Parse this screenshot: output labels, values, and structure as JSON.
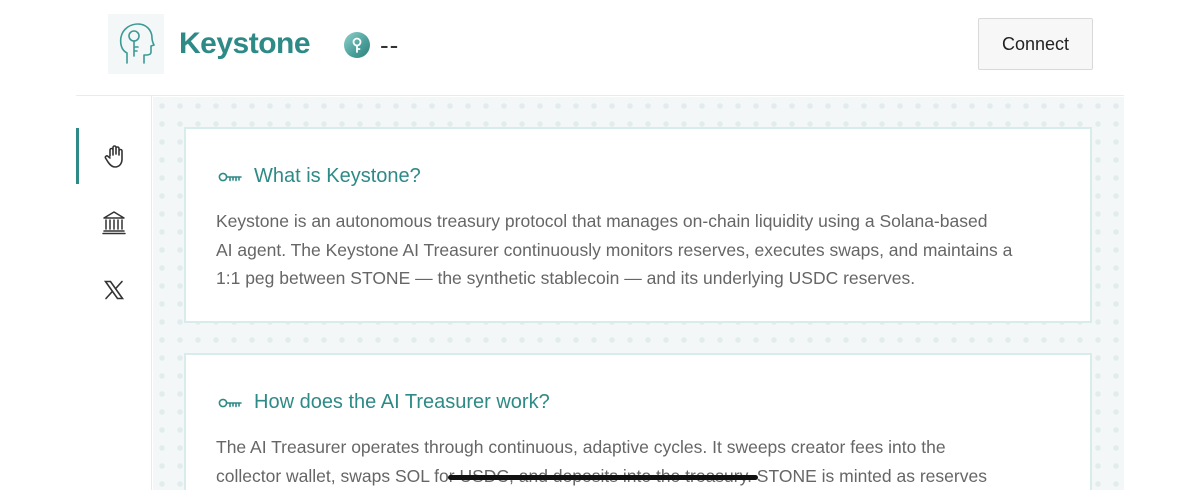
{
  "header": {
    "brand": "Keystone",
    "token_value": "--",
    "connect_label": "Connect"
  },
  "sidebar": {
    "items": [
      {
        "icon": "hand-icon",
        "active": true
      },
      {
        "icon": "bank-icon",
        "active": false
      },
      {
        "icon": "x-logo-icon",
        "active": false
      }
    ]
  },
  "faq": [
    {
      "title": "What is Keystone?",
      "body_lines": [
        "Keystone is an autonomous treasury protocol that manages on-chain liquidity using a Solana-based",
        "AI agent. The Keystone AI Treasurer continuously monitors reserves, executes swaps, and maintains a",
        "1:1 peg between STONE — the synthetic stablecoin — and its underlying USDC reserves."
      ]
    },
    {
      "title": "How does the AI Treasurer work?",
      "body_lines": [
        "The AI Treasurer operates through continuous, adaptive cycles. It sweeps creator fees into the",
        "collector wallet, swaps SOL for USDC, and deposits into the treasury. STONE is minted as reserves"
      ]
    }
  ],
  "colors": {
    "accent": "#2e8a86",
    "body_text": "#666666",
    "card_border": "#d8ecec",
    "background": "#f3f7f7"
  }
}
